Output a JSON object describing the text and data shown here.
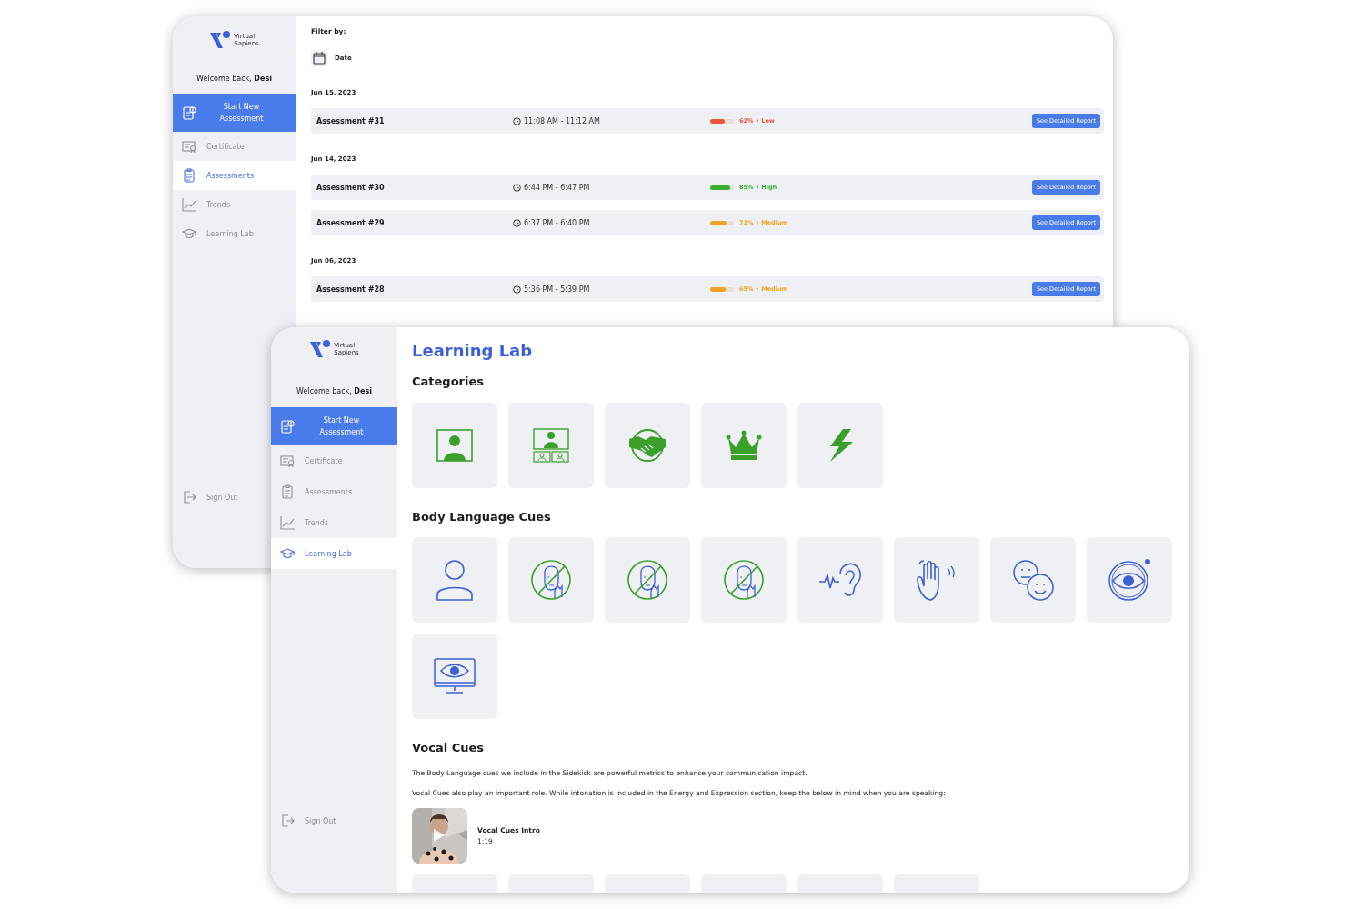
{
  "assessments_window": {
    "sidebar": {
      "logo": [
        "Virtual",
        "Sapiens"
      ],
      "welcome": "Welcome back, **Desi**",
      "start_button": "Start New Assessment",
      "items": [
        {
          "kind": "certificate",
          "label": "Certificate",
          "selected": false
        },
        {
          "kind": "assessments",
          "label": "Assessments",
          "selected": true
        },
        {
          "kind": "trends",
          "label": "Trends",
          "selected": false
        },
        {
          "kind": "learning",
          "label": "Learning Lab",
          "selected": false
        }
      ],
      "sign_out": "Sign Out"
    },
    "filter_label": "Filter by:",
    "filter_chip": "Date",
    "groups": [
      {
        "date": "Jun 15, 2023",
        "rows": [
          {
            "name": "Assessment #31",
            "time": "11:08 AM - 11:12 AM",
            "score": {
              "level": 0.62,
              "label": "62% • Low",
              "color": "#e8553a"
            },
            "button": "See Detailed Report"
          }
        ]
      },
      {
        "date": "Jun 14, 2023",
        "rows": [
          {
            "name": "Assessment #30",
            "time": "6:44 PM - 6:47 PM",
            "score": {
              "level": 0.85,
              "label": "85% • High",
              "color": "#3aae2e"
            },
            "button": "See Detailed Report"
          },
          {
            "name": "Assessment #29",
            "time": "6:37 PM - 6:40 PM",
            "score": {
              "level": 0.71,
              "label": "71% • Medium",
              "color": "#f0a323"
            },
            "button": "See Detailed Report"
          }
        ]
      },
      {
        "date": "Jun 06, 2023",
        "rows": [
          {
            "name": "Assessment #28",
            "time": "5:36 PM - 5:39 PM",
            "score": {
              "level": 0.65,
              "label": "65% • Medium",
              "color": "#f0a323"
            },
            "button": "See Detailed Report"
          }
        ]
      }
    ]
  },
  "learning_lab_window": {
    "sidebar": {
      "logo": [
        "Virtual",
        "Sapiens"
      ],
      "welcome": "Welcome back, **Desi**",
      "start_button": "Start New Assessment",
      "items": [
        {
          "kind": "certificate",
          "label": "Certificate",
          "selected": false
        },
        {
          "kind": "assessments",
          "label": "Assessments",
          "selected": false
        },
        {
          "kind": "trends",
          "label": "Trends",
          "selected": false
        },
        {
          "kind": "learning",
          "label": "Learning Lab",
          "selected": true
        }
      ],
      "sign_out": "Sign Out"
    },
    "title": "Learning Lab",
    "categories": {
      "heading": "Categories",
      "tiles": [
        {
          "kind": "presenter"
        },
        {
          "kind": "videocall"
        },
        {
          "kind": "handshake"
        },
        {
          "kind": "crown"
        },
        {
          "kind": "lightning"
        }
      ]
    },
    "body_language": {
      "heading": "Body Language Cues",
      "tiles": [
        {
          "kind": "person"
        },
        {
          "kind": "notouch"
        },
        {
          "kind": "notouch"
        },
        {
          "kind": "notouch"
        },
        {
          "kind": "ear"
        },
        {
          "kind": "wave"
        },
        {
          "kind": "faces"
        },
        {
          "kind": "eye"
        },
        {
          "kind": "screeneye"
        }
      ]
    },
    "vocal_cues": {
      "heading": "Vocal Cues",
      "paragraphs": [
        "The Body Language cues we include in the Sidekick are powerful metrics to enhance your communication impact.",
        "Vocal Cues also play an important role. While intonation is included in the Energy and Expression section, keep the below in mind when you are speaking:"
      ],
      "video": {
        "kind": "picture",
        "title": "Vocal Cues Intro",
        "duration": "1:19"
      },
      "tiles": [
        {
          "kind": "blank"
        },
        {
          "kind": "blank"
        },
        {
          "kind": "blank"
        },
        {
          "kind": "blank"
        },
        {
          "kind": "blank"
        },
        {
          "kind": "blank"
        }
      ]
    }
  }
}
